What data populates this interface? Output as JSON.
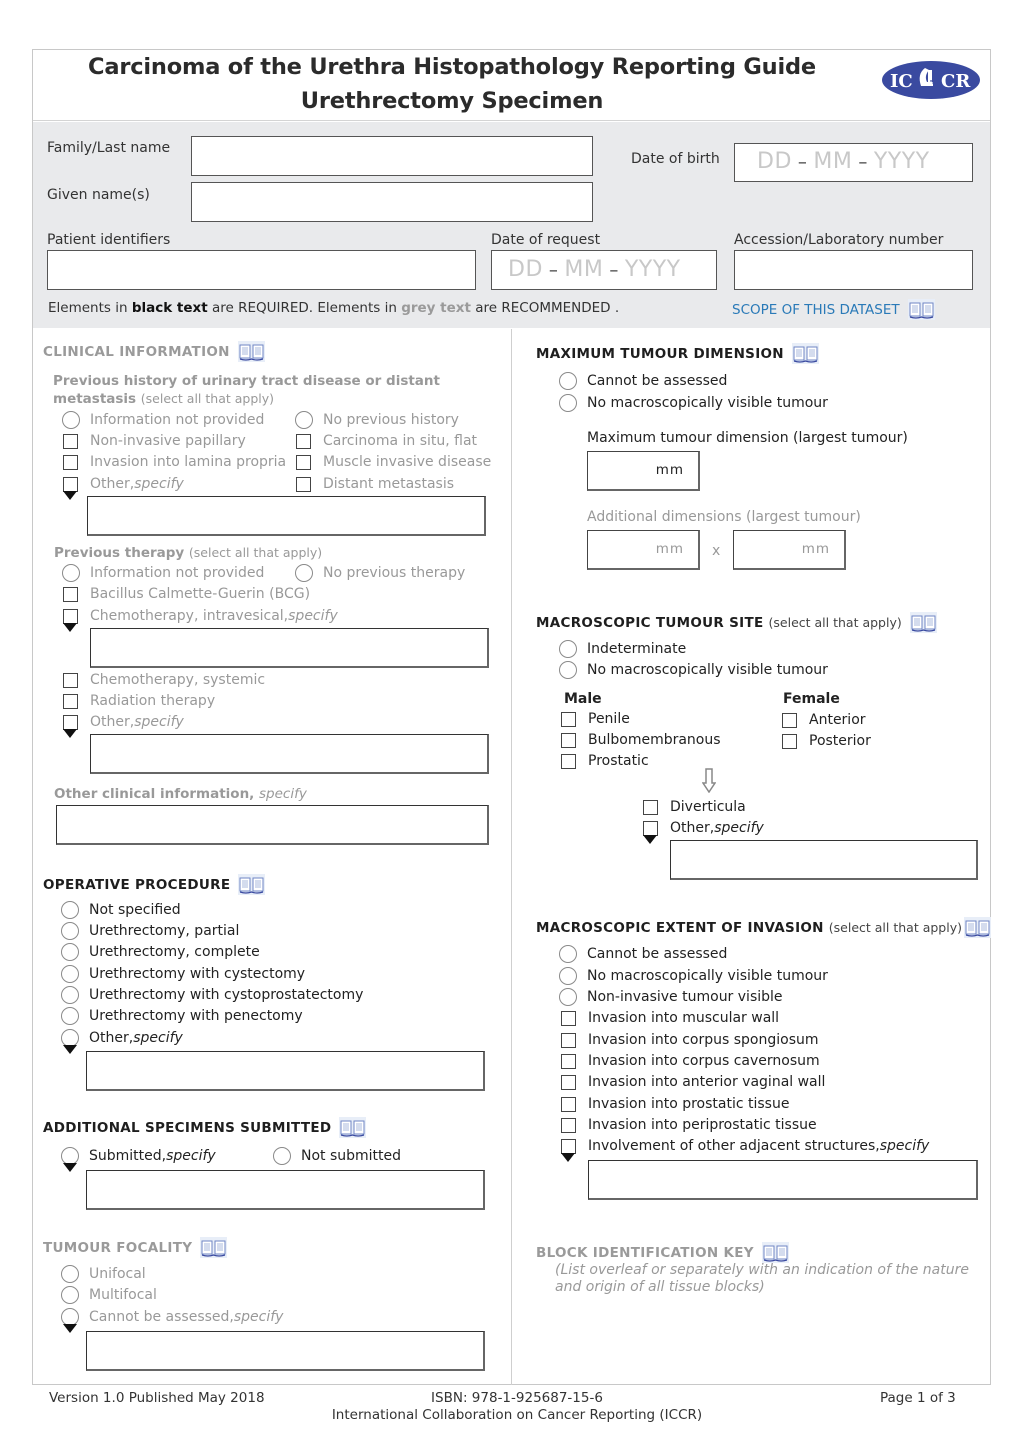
{
  "header": {
    "title_line1": "Carcinoma of the Urethra Histopathology Reporting Guide",
    "title_line2": "Urethrectomy Specimen",
    "logo": "ICCR"
  },
  "patient": {
    "family_name_label": "Family/Last name",
    "family_name_value": "",
    "given_names_label": "Given name(s)",
    "given_names_value": "",
    "dob_label": "Date of birth",
    "dob_placeholder": {
      "dd": "DD",
      "mm": "MM",
      "yyyy": "YYYY",
      "sep": "–"
    },
    "patient_identifiers_label": "Patient identifiers",
    "patient_identifiers_value": "",
    "date_of_request_label": "Date of request",
    "date_of_request_placeholder": {
      "dd": "DD",
      "mm": "MM",
      "yyyy": "YYYY",
      "sep": "–"
    },
    "accession_label": "Accession/Laboratory number",
    "accession_value": "",
    "note": {
      "p1": "Elements in ",
      "black": "black text",
      "p2": " are REQUIRED. Elements in ",
      "grey": "grey text",
      "p3": " are RECOMMENDED ."
    },
    "scope_link": "SCOPE OF THIS DATASET"
  },
  "clinical": {
    "title": "CLINICAL INFORMATION",
    "history": {
      "label_bold": "Previous history of urinary tract disease or distant metastasis",
      "label_note": "(select all that apply)",
      "options": [
        {
          "type": "radio",
          "label": "Information not provided"
        },
        {
          "type": "radio",
          "label": "No previous history"
        },
        {
          "type": "checkbox",
          "label": "Non-invasive papillary"
        },
        {
          "type": "checkbox",
          "label": "Carcinoma in situ, flat"
        },
        {
          "type": "checkbox",
          "label": "Invasion into lamina propria"
        },
        {
          "type": "checkbox",
          "label": "Muscle invasive disease"
        },
        {
          "type": "checkbox",
          "label": "Other, ",
          "specify": "specify"
        },
        {
          "type": "checkbox",
          "label": "Distant metastasis"
        }
      ]
    },
    "therapy": {
      "label_bold": "Previous therapy",
      "label_note": "(select all that apply)",
      "options": [
        {
          "type": "radio",
          "label": "Information not provided"
        },
        {
          "type": "radio",
          "label": "No previous therapy"
        },
        {
          "type": "checkbox",
          "label": "Bacillus Calmette-Guerin (BCG)"
        },
        {
          "type": "checkbox",
          "label": "Chemotherapy, intravesical, ",
          "specify": "specify"
        },
        {
          "type": "checkbox",
          "label": "Chemotherapy, systemic"
        },
        {
          "type": "checkbox",
          "label": "Radiation therapy"
        },
        {
          "type": "checkbox",
          "label": "Other, ",
          "specify": "specify"
        }
      ]
    },
    "other_info": {
      "label_bold": "Other clinical information,",
      "specify": "specify"
    }
  },
  "operative": {
    "title": "OPERATIVE PROCEDURE",
    "options": [
      {
        "type": "radio",
        "label": "Not specified"
      },
      {
        "type": "radio",
        "label": "Urethrectomy, partial"
      },
      {
        "type": "radio",
        "label": "Urethrectomy, complete"
      },
      {
        "type": "radio",
        "label": "Urethrectomy with cystectomy"
      },
      {
        "type": "radio",
        "label": "Urethrectomy with cystoprostatectomy"
      },
      {
        "type": "radio",
        "label": "Urethrectomy with penectomy"
      },
      {
        "type": "radio",
        "label": "Other, ",
        "specify": "specify"
      }
    ]
  },
  "additional_specimens": {
    "title": "ADDITIONAL SPECIMENS SUBMITTED",
    "options": [
      {
        "type": "radio",
        "label": "Submitted, ",
        "specify": "specify"
      },
      {
        "type": "radio",
        "label": "Not submitted"
      }
    ]
  },
  "focality": {
    "title": "TUMOUR FOCALITY",
    "options": [
      {
        "type": "radio",
        "label": "Unifocal"
      },
      {
        "type": "radio",
        "label": "Multifocal"
      },
      {
        "type": "radio",
        "label": "Cannot be assessed, ",
        "specify": "specify"
      }
    ]
  },
  "max_dimension": {
    "title": "MAXIMUM TUMOUR DIMENSION",
    "options": [
      {
        "type": "radio",
        "label": "Cannot be assessed"
      },
      {
        "type": "radio",
        "label": "No macroscopically visible tumour"
      }
    ],
    "largest_label": "Maximum tumour dimension (largest tumour)",
    "unit": "mm",
    "additional_label": "Additional dimensions (largest tumour)",
    "times": "x"
  },
  "tumour_site": {
    "title": "MACROSCOPIC TUMOUR SITE",
    "note": "(select all that apply)",
    "options": [
      {
        "type": "radio",
        "label": "Indeterminate"
      },
      {
        "type": "radio",
        "label": "No macroscopically visible tumour"
      }
    ],
    "male_label": "Male",
    "male_options": [
      "Penile",
      "Bulbomembranous",
      "Prostatic"
    ],
    "female_label": "Female",
    "female_options": [
      "Anterior",
      "Posterior"
    ],
    "common_options": [
      {
        "type": "checkbox",
        "label": "Diverticula"
      },
      {
        "type": "checkbox",
        "label": "Other, ",
        "specify": "specify"
      }
    ]
  },
  "extent": {
    "title": "MACROSCOPIC EXTENT OF INVASION",
    "note": "(select all that apply)",
    "options": [
      {
        "type": "radio",
        "label": "Cannot be assessed"
      },
      {
        "type": "radio",
        "label": "No macroscopically visible tumour"
      },
      {
        "type": "radio",
        "label": "Non-invasive tumour visible"
      },
      {
        "type": "checkbox",
        "label": "Invasion into muscular wall"
      },
      {
        "type": "checkbox",
        "label": "Invasion into corpus spongiosum"
      },
      {
        "type": "checkbox",
        "label": "Invasion into corpus cavernosum"
      },
      {
        "type": "checkbox",
        "label": "Invasion into anterior vaginal wall"
      },
      {
        "type": "checkbox",
        "label": "Invasion into prostatic tissue"
      },
      {
        "type": "checkbox",
        "label": "Invasion into periprostatic tissue"
      },
      {
        "type": "checkbox",
        "label": "Involvement of other adjacent structures, ",
        "specify": "specify"
      }
    ]
  },
  "block_key": {
    "title": "BLOCK IDENTIFICATION KEY",
    "note_line1": "(List overleaf or separately with an indication of the nature",
    "note_line2": "and origin of all tissue blocks)"
  },
  "footer": {
    "version": "Version 1.0  Published May 2018",
    "isbn": "ISBN: 978-1-925687-15-6",
    "org": "International Collaboration on Cancer Reporting (ICCR)",
    "page": "Page 1 of 3"
  },
  "colors": {
    "required_text": "#222222",
    "recommended_text": "#999999",
    "link": "#2a7ab8",
    "panel_bg": "#e9eaec",
    "logo_blue": "#3a4aa0"
  }
}
